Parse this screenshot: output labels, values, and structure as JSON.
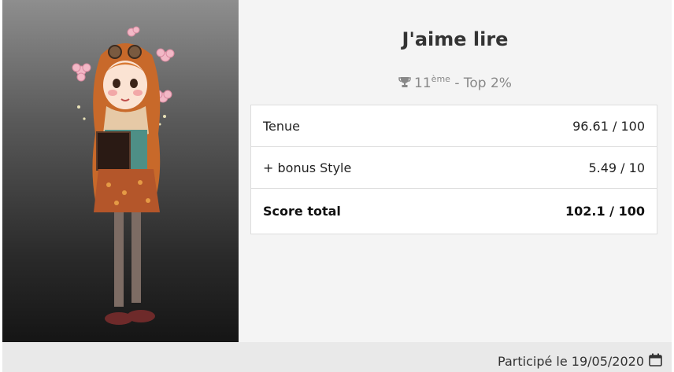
{
  "contest": {
    "title": "J'aime lire"
  },
  "rank": {
    "position": "11",
    "suffix": "ème",
    "top_text": " - Top 2%"
  },
  "scores": {
    "tenue_label": "Tenue",
    "tenue_value": "96.61 / 100",
    "bonus_label": "+ bonus Style",
    "bonus_value": "5.49 / 10",
    "total_label": "Score total",
    "total_value": "102.1 / 100"
  },
  "footer": {
    "participated_text": "Participé le 19/05/2020"
  },
  "icons": {
    "rank": "trophy-icon",
    "date": "calendar-icon"
  },
  "colors": {
    "bonus": "#e0228e",
    "muted_value": "#888888"
  }
}
